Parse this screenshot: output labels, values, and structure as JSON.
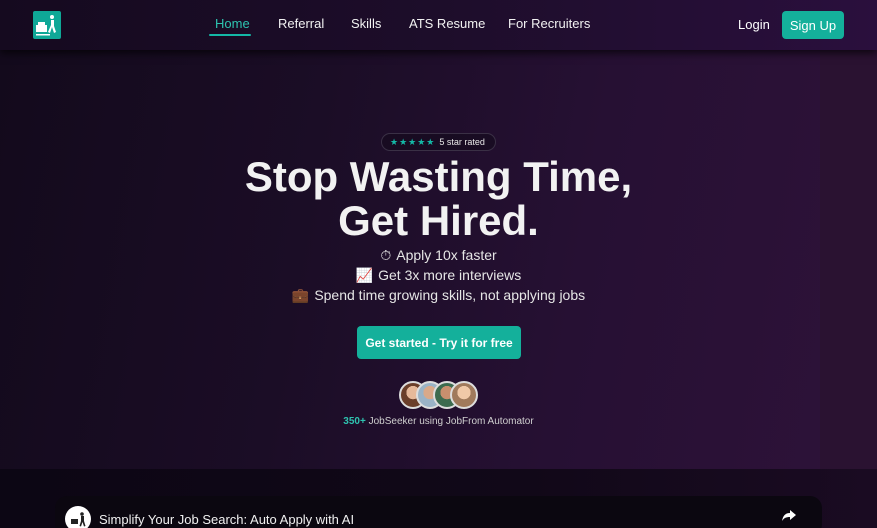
{
  "nav": {
    "logo_icon": "walking-person-logo-icon",
    "links": [
      {
        "label": "Home",
        "active": true
      },
      {
        "label": "Referral",
        "active": false
      },
      {
        "label": "Skills",
        "active": false
      },
      {
        "label": "ATS Resume",
        "active": false
      },
      {
        "label": "For Recruiters",
        "active": false
      }
    ],
    "login_label": "Login",
    "signup_label": "Sign Up"
  },
  "hero": {
    "rating_stars": "★★★★★",
    "rating_text": "5 star rated",
    "headline_line1": "Stop Wasting Time,",
    "headline_line2": "Get Hired.",
    "features": [
      {
        "emoji": "⏱",
        "text": "Apply 10x faster"
      },
      {
        "emoji": "📈",
        "text": "Get 3x more interviews"
      },
      {
        "emoji": "💼",
        "text": "Spend time growing skills, not applying jobs"
      }
    ],
    "cta_label": "Get started - Try it for free",
    "social_count": "350+",
    "social_text": " JobSeeker using JobFrom Automator"
  },
  "video": {
    "title": "Simplify Your Job Search: Auto Apply with AI",
    "share_icon": "share-arrow-icon"
  },
  "colors": {
    "accent": "#14b09b",
    "accent_text": "#2ec4b0",
    "background": "#0d0616"
  }
}
